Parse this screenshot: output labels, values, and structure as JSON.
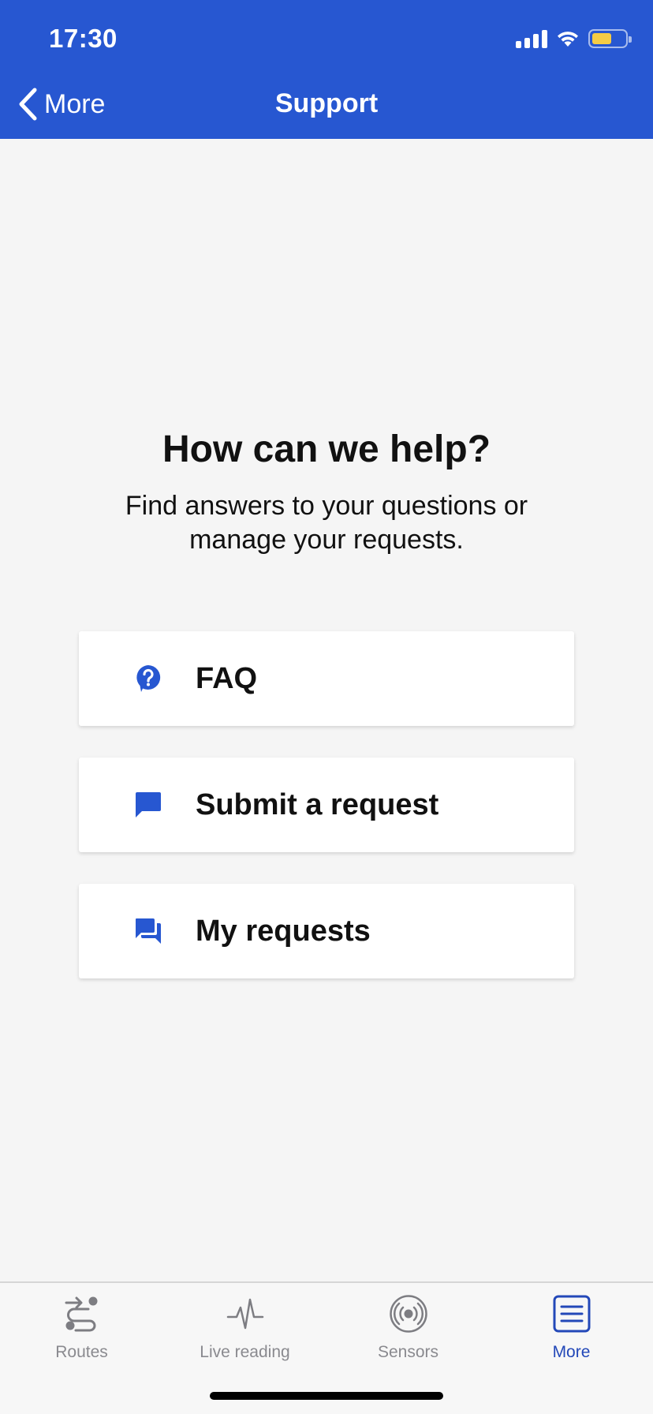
{
  "status_bar": {
    "time": "17:30",
    "icons": [
      "cellular-signal-icon",
      "wifi-icon",
      "battery-icon"
    ],
    "battery_fill_fraction": 0.6,
    "battery_color": "#f5cc45"
  },
  "nav": {
    "back_label": "More",
    "title": "Support"
  },
  "help": {
    "title": "How can we help?",
    "subtitle": "Find answers to your questions or manage your requests."
  },
  "options": [
    {
      "label": "FAQ",
      "icon": "question-bubble-icon"
    },
    {
      "label": "Submit a request",
      "icon": "chat-bubble-icon"
    },
    {
      "label": "My requests",
      "icon": "chat-bubbles-icon"
    }
  ],
  "tabs": [
    {
      "label": "Routes",
      "icon": "routes-icon",
      "active": false
    },
    {
      "label": "Live reading",
      "icon": "pulse-icon",
      "active": false
    },
    {
      "label": "Sensors",
      "icon": "sensor-icon",
      "active": false
    },
    {
      "label": "More",
      "icon": "menu-list-icon",
      "active": true
    }
  ],
  "colors": {
    "brand": "#2757d1",
    "tab_active": "#2348b8",
    "tab_inactive": "#8a8a8f",
    "background": "#f5f5f5"
  }
}
